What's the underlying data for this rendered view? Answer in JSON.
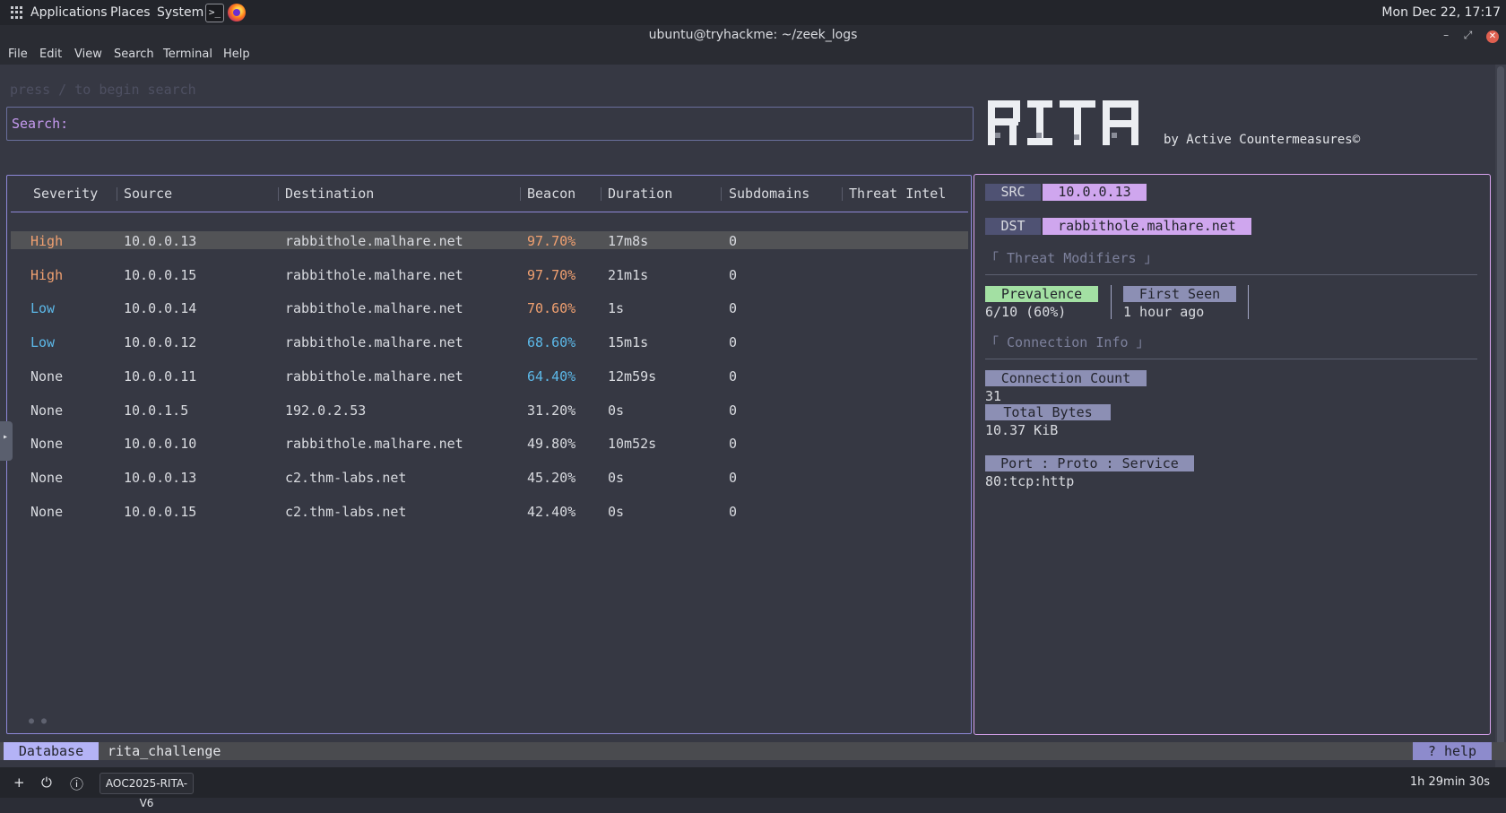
{
  "system_bar": {
    "applications": "Applications",
    "places": "Places",
    "system": "System",
    "clock": "Mon Dec 22, 17:17"
  },
  "window": {
    "title": "ubuntu@tryhackme: ~/zeek_logs"
  },
  "menu": {
    "items": [
      "File",
      "Edit",
      "View",
      "Search",
      "Terminal",
      "Help"
    ]
  },
  "search": {
    "hint": "press / to begin search",
    "label": "Search:"
  },
  "logo": {
    "text": "RITA",
    "byline": "by Active Countermeasures©"
  },
  "table": {
    "columns": [
      "Severity",
      "Source",
      "Destination",
      "Beacon",
      "Duration",
      "Subdomains",
      "Threat Intel"
    ],
    "rows": [
      {
        "severity": "High",
        "source": "10.0.0.13",
        "destination": "rabbithole.malhare.net",
        "beacon": "97.70%",
        "duration": "17m8s",
        "subdomains": "0",
        "selected": true
      },
      {
        "severity": "High",
        "source": "10.0.0.15",
        "destination": "rabbithole.malhare.net",
        "beacon": "97.70%",
        "duration": "21m1s",
        "subdomains": "0"
      },
      {
        "severity": "Low",
        "source": "10.0.0.14",
        "destination": "rabbithole.malhare.net",
        "beacon": "70.60%",
        "duration": "1s",
        "subdomains": "0"
      },
      {
        "severity": "Low",
        "source": "10.0.0.12",
        "destination": "rabbithole.malhare.net",
        "beacon": "68.60%",
        "duration": "15m1s",
        "subdomains": "0"
      },
      {
        "severity": "None",
        "source": "10.0.0.11",
        "destination": "rabbithole.malhare.net",
        "beacon": "64.40%",
        "duration": "12m59s",
        "subdomains": "0"
      },
      {
        "severity": "None",
        "source": "10.0.1.5",
        "destination": "192.0.2.53",
        "beacon": "31.20%",
        "duration": "0s",
        "subdomains": "0"
      },
      {
        "severity": "None",
        "source": "10.0.0.10",
        "destination": "rabbithole.malhare.net",
        "beacon": "49.80%",
        "duration": "10m52s",
        "subdomains": "0"
      },
      {
        "severity": "None",
        "source": "10.0.0.13",
        "destination": "c2.thm-labs.net",
        "beacon": "45.20%",
        "duration": "0s",
        "subdomains": "0"
      },
      {
        "severity": "None",
        "source": "10.0.0.15",
        "destination": "c2.thm-labs.net",
        "beacon": "42.40%",
        "duration": "0s",
        "subdomains": "0"
      }
    ]
  },
  "colors": {
    "high": "#f0a070",
    "low": "#5cb8e8",
    "none": "#d9dbe0",
    "beacon_high": "#f0a070",
    "beacon_mid": "#5cb8e8",
    "beacon_low": "#d9dbe0"
  },
  "details": {
    "src_label": "SRC",
    "src_value": "10.0.0.13",
    "dst_label": "DST",
    "dst_value": "rabbithole.malhare.net",
    "threat_modifiers_title": "「 Threat Modifiers 」",
    "prevalence_label": "Prevalence",
    "prevalence_value": "6/10 (60%)",
    "first_seen_label": "First Seen",
    "first_seen_value": "1 hour ago",
    "connection_info_title": "「 Connection Info 」",
    "connection_count_label": "Connection Count",
    "connection_count_value": "31",
    "total_bytes_label": "Total Bytes",
    "total_bytes_value": "10.37 KiB",
    "port_label": "Port : Proto : Service",
    "port_value": "80:tcp:http"
  },
  "status": {
    "db_label": "Database",
    "db_name": "rita_challenge",
    "help": "? help"
  },
  "taskbar": {
    "task": "AOC2025-RITA-V6",
    "timer": "1h 29min 30s"
  }
}
